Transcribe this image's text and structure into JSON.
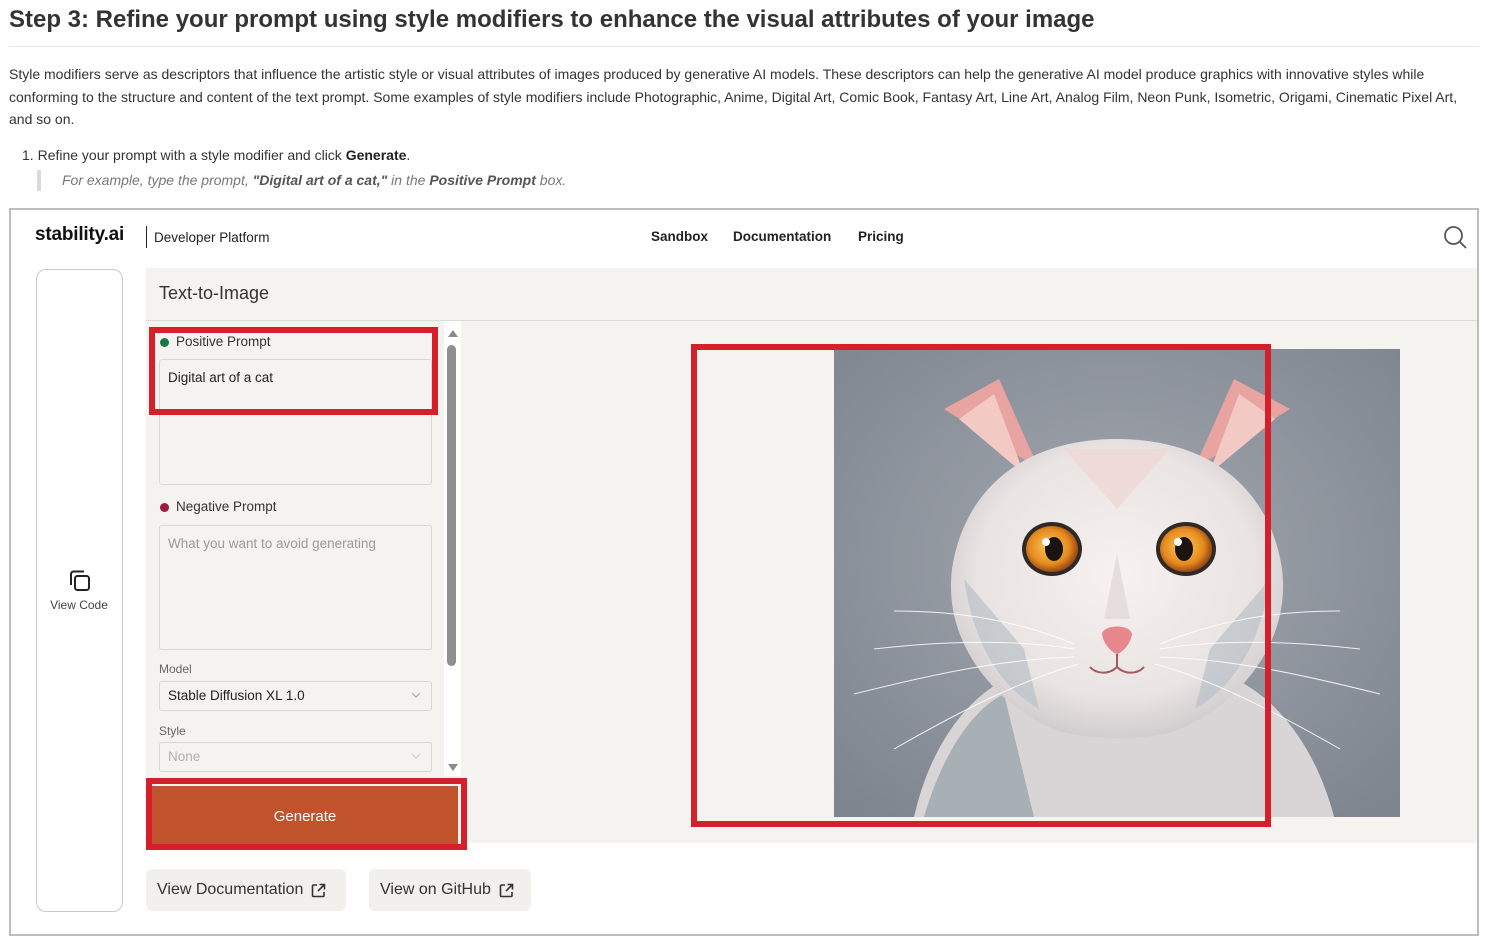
{
  "doc": {
    "title": "Step 3: Refine your prompt using style modifiers to enhance the visual attributes of your image",
    "paragraph": "Style modifiers serve as descriptors that influence the artistic style or visual attributes of images produced by generative AI models. These descriptors can help the generative AI model produce graphics with innovative styles while conforming to the structure and content of the text prompt. Some examples of style modifiers include Photographic, Anime, Digital Art, Comic Book, Fantasy Art, Line Art, Analog Film, Neon Punk, Isometric, Origami, Cinematic Pixel Art, and so on.",
    "step": {
      "number": "1.",
      "text_before": "Refine your prompt with a style modifier and click ",
      "bold": "Generate",
      "text_after": "."
    },
    "note": {
      "before": "For example, type the prompt, ",
      "prompt": "\"Digital art of a cat,\"",
      "middle": " in the ",
      "field": "Positive Prompt",
      "after": " box."
    }
  },
  "screenshot": {
    "header": {
      "logo": "stability.ai",
      "subbrand": "Developer Platform",
      "nav": [
        "Sandbox",
        "Documentation",
        "Pricing"
      ],
      "search_icon": "search-icon"
    },
    "sidebar": {
      "view_code_label": "View Code",
      "view_code_icon": "copy-icon"
    },
    "panel": {
      "title": "Text-to-Image",
      "positive_prompt": {
        "label": "Positive Prompt",
        "value": "Digital art of a cat",
        "dot_color": "#157a46"
      },
      "negative_prompt": {
        "label": "Negative Prompt",
        "placeholder": "What you want to avoid generating",
        "dot_color": "#9e1b3c"
      },
      "model": {
        "label": "Model",
        "value": "Stable Diffusion XL 1.0"
      },
      "style": {
        "label": "Style",
        "value": "None"
      },
      "generate_label": "Generate",
      "generate_color": "#c0522c"
    },
    "links": {
      "docs": "View Documentation",
      "github": "View on GitHub"
    },
    "highlight_color": "#d51f2b"
  }
}
